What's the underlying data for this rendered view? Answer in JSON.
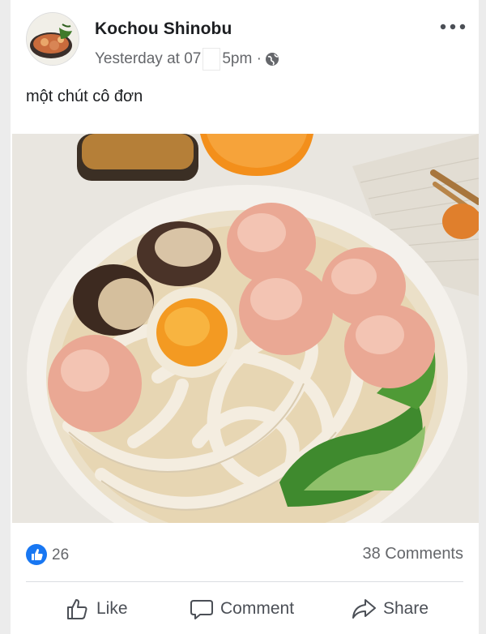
{
  "post": {
    "author": "Kochou Shinobu",
    "timestamp_before": "Yesterday at 07",
    "timestamp_after": "5pm ·",
    "caption": "một chút cô đơn",
    "privacy_icon": "globe-icon"
  },
  "stats": {
    "likes": "26",
    "comments": "38 Comments",
    "reaction_icon": "like-reaction-icon"
  },
  "actions": {
    "like_label": "Like",
    "comment_label": "Comment",
    "share_label": "Share"
  },
  "colors": {
    "like_blue": "#1877f2",
    "text_primary": "#1c1e21",
    "text_secondary": "#65676b"
  }
}
